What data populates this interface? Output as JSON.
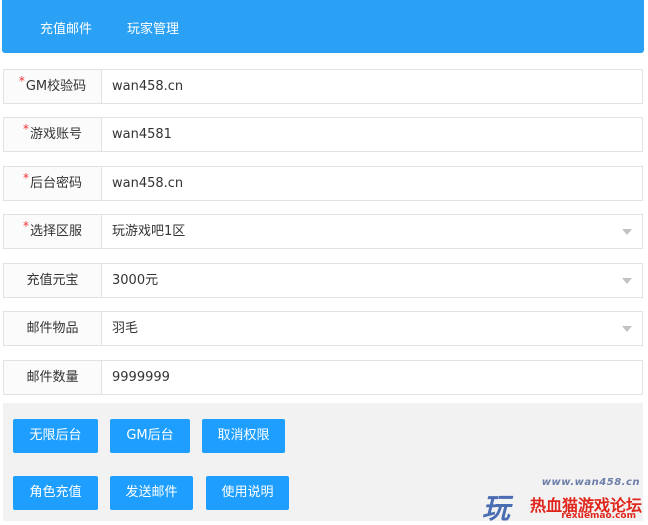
{
  "header": {
    "tabs": [
      {
        "label": "充值邮件"
      },
      {
        "label": "玩家管理"
      }
    ]
  },
  "form": {
    "rows": [
      {
        "label": "GM校验码",
        "value": "wan458.cn",
        "required": true
      },
      {
        "label": "游戏账号",
        "value": "wan4581",
        "required": true
      },
      {
        "label": "后台密码",
        "value": "wan458.cn",
        "required": true
      },
      {
        "label": "选择区服",
        "value": "玩游戏吧1区",
        "required": true,
        "dropdown": true
      },
      {
        "label": "充值元宝",
        "value": "3000元",
        "required": false,
        "dropdown": true
      },
      {
        "label": "邮件物品",
        "value": "羽毛",
        "required": false,
        "dropdown": true
      },
      {
        "label": "邮件数量",
        "value": "9999999",
        "required": false
      }
    ],
    "required_mark": "*"
  },
  "buttons": {
    "unlimited_backend": "无限后台",
    "gm_backend": "GM后台",
    "revoke_permission": "取消权限",
    "role_recharge": "角色充值",
    "send_mail": "发送邮件",
    "instructions": "使用说明"
  },
  "watermark": {
    "url": "www.wan458.cn",
    "glyph": "玩",
    "title": "热血猫游戏论坛",
    "subtitle": "rexuemao.com"
  },
  "colors": {
    "header_bg": "#2aa1f5",
    "button_bg": "#1e9fff",
    "required_star": "#e33333",
    "watermark_red": "#e0261c"
  }
}
